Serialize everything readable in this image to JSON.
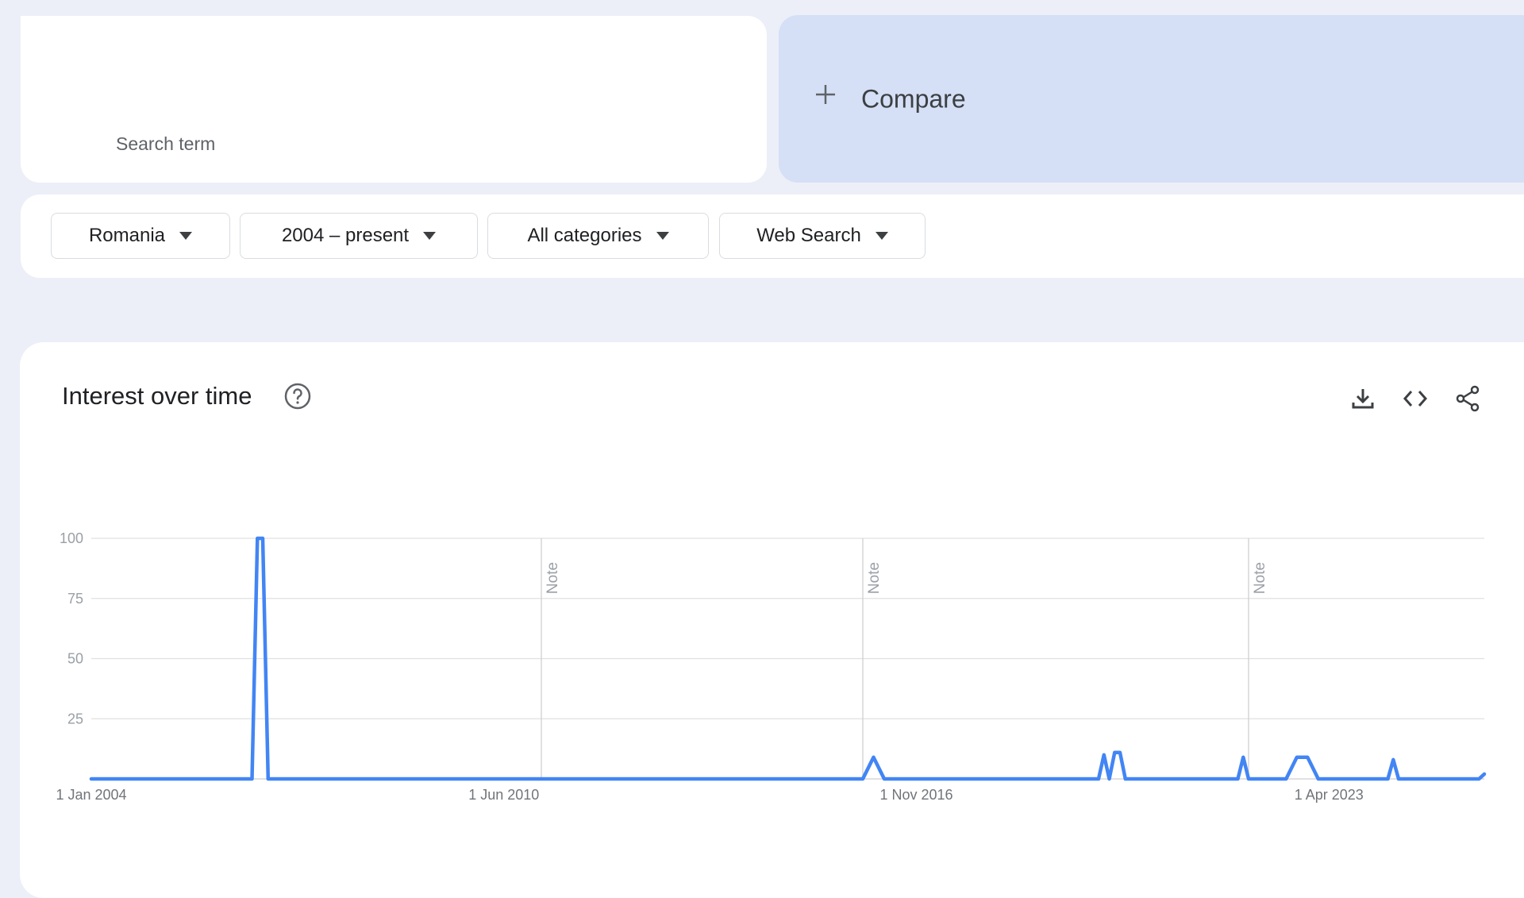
{
  "search": {
    "placeholder": "Search term"
  },
  "compare": {
    "label": "Compare",
    "icon": "plus-icon"
  },
  "filters": {
    "region": "Romania",
    "time": "2004 – present",
    "category": "All categories",
    "property": "Web Search"
  },
  "panel": {
    "title": "Interest over time",
    "help_icon": "help-circle-icon",
    "tools": [
      "download-icon",
      "embed-code-icon",
      "share-icon"
    ]
  },
  "colors": {
    "line": "#4285f4",
    "compare_bg": "#d5e0f6",
    "page_bg": "#eceff8"
  },
  "chart_data": {
    "type": "line",
    "x_start": "2004-01",
    "x_end": "2025-09",
    "x_ticks": [
      {
        "label": "1 Jan 2004",
        "date": "2004-01"
      },
      {
        "label": "1 Jun 2010",
        "date": "2010-06"
      },
      {
        "label": "1 Nov 2016",
        "date": "2016-11"
      },
      {
        "label": "1 Apr 2023",
        "date": "2023-04"
      }
    ],
    "y_ticks": [
      25,
      50,
      75,
      100
    ],
    "ylim": [
      0,
      100
    ],
    "grid": true,
    "notes": [
      {
        "label": "Note",
        "date": "2011-01"
      },
      {
        "label": "Note",
        "date": "2016-01"
      },
      {
        "label": "Note",
        "date": "2022-01"
      }
    ],
    "points": [
      {
        "x": "2004-01",
        "y": 0
      },
      {
        "x": "2006-07",
        "y": 0
      },
      {
        "x": "2006-08",
        "y": 100
      },
      {
        "x": "2006-09",
        "y": 100
      },
      {
        "x": "2006-10",
        "y": 0
      },
      {
        "x": "2016-01",
        "y": 0
      },
      {
        "x": "2016-03",
        "y": 9
      },
      {
        "x": "2016-05",
        "y": 0
      },
      {
        "x": "2019-09",
        "y": 0
      },
      {
        "x": "2019-10",
        "y": 10
      },
      {
        "x": "2019-11",
        "y": 0
      },
      {
        "x": "2019-12",
        "y": 11
      },
      {
        "x": "2020-01",
        "y": 11
      },
      {
        "x": "2020-02",
        "y": 0
      },
      {
        "x": "2021-11",
        "y": 0
      },
      {
        "x": "2021-12",
        "y": 9
      },
      {
        "x": "2022-01",
        "y": 0
      },
      {
        "x": "2022-08",
        "y": 0
      },
      {
        "x": "2022-10",
        "y": 9
      },
      {
        "x": "2022-12",
        "y": 9
      },
      {
        "x": "2023-02",
        "y": 0
      },
      {
        "x": "2024-03",
        "y": 0
      },
      {
        "x": "2024-04",
        "y": 8
      },
      {
        "x": "2024-05",
        "y": 0
      },
      {
        "x": "2025-08",
        "y": 0
      },
      {
        "x": "2025-09",
        "y": 2
      }
    ]
  }
}
